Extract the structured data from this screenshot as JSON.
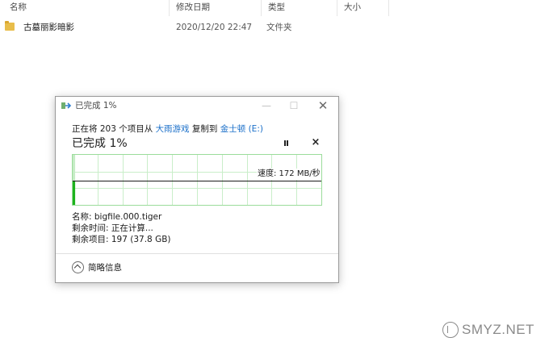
{
  "columns": {
    "name": "名称",
    "date": "修改日期",
    "type": "类型",
    "size": "大小"
  },
  "file": {
    "name": "古墓丽影暗影",
    "date": "2020/12/20 22:47",
    "type": "文件夹"
  },
  "dialog": {
    "title": "已完成 1%",
    "copy_prefix": "正在将 203 个项目从 ",
    "source": "大雨游戏",
    "copy_mid": " 复制到 ",
    "destination": "金士顿 (E:)",
    "status": "已完成 1%",
    "progress_percent": 1,
    "speed": "速度: 172 MB/秒",
    "name_line": "名称: bigfile.000.tiger",
    "time_line": "剩余时间: 正在计算...",
    "items_line": "剩余项目: 197 (37.8 GB)",
    "details_label": "简略信息"
  },
  "watermark": {
    "text": "SMYZ.NET"
  },
  "colors": {
    "graph_fill": "#1db31d",
    "graph_grid": "#c9eec9",
    "link": "#1a6fc9"
  }
}
